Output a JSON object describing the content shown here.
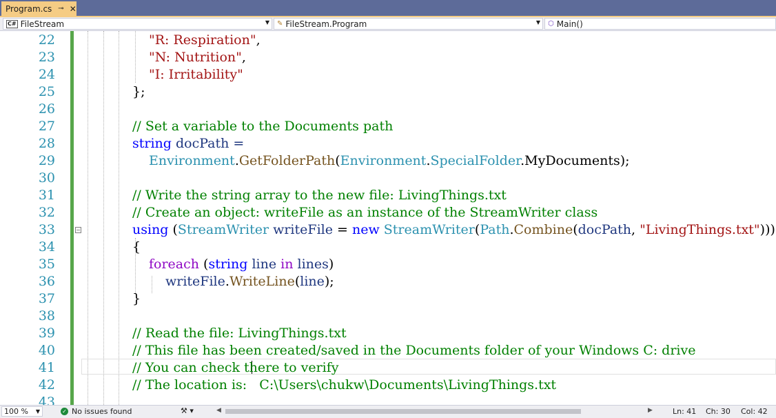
{
  "tab": {
    "title": "Program.cs",
    "pin_glyph": "⊸",
    "close_glyph": "✕"
  },
  "navbar": {
    "project": "FileStream",
    "class": "FileStream.Program",
    "member": "Main()"
  },
  "editor": {
    "line_numbers": [
      "22",
      "23",
      "24",
      "25",
      "26",
      "27",
      "28",
      "29",
      "30",
      "31",
      "32",
      "33",
      "34",
      "35",
      "36",
      "37",
      "38",
      "39",
      "40",
      "41",
      "42",
      "43"
    ]
  },
  "code": {
    "l22": "\"R: Respiration\"",
    "l22b": ",",
    "l23": "\"N: Nutrition\"",
    "l23b": ",",
    "l24": "\"I: Irritability\"",
    "l25": "};",
    "l27": "// Set a variable to the Documents path",
    "l28_kw": "string",
    "l28_rest": " docPath =",
    "l29_t1": "Environment",
    "l29_d1": ".",
    "l29_m1": "GetFolderPath",
    "l29_p1": "(",
    "l29_t2": "Environment",
    "l29_d2": ".",
    "l29_t3": "SpecialFolder",
    "l29_rest": ".MyDocuments);",
    "l31": "// Write the string array to the new file: LivingThings.txt",
    "l32": "// Create an object: writeFile as an instance of the StreamWriter class",
    "l33_kw": "using",
    "l33_p1": " (",
    "l33_t1": "StreamWriter",
    "l33_v1": " writeFile",
    "l33_eq": " = ",
    "l33_kw2": "new",
    "l33_sp": " ",
    "l33_t2": "StreamWriter",
    "l33_p2": "(",
    "l33_t3": "Path",
    "l33_d": ".",
    "l33_m": "Combine",
    "l33_p3": "(",
    "l33_v2": "docPath",
    "l33_c": ", ",
    "l33_s": "\"LivingThings.txt\"",
    "l33_end": ")))",
    "l34": "{",
    "l35_kw": "foreach",
    "l35_p1": " (",
    "l35_kw2": "string",
    "l35_v1": " line",
    "l35_sp": " ",
    "l35_kw3": "in",
    "l35_v2": " lines",
    "l35_end": ")",
    "l36_v": "writeFile",
    "l36_d": ".",
    "l36_m": "WriteLine",
    "l36_p": "(",
    "l36_v2": "line",
    "l36_end": ");",
    "l37": "}",
    "l39": "// Read the file: LivingThings.txt",
    "l40": "// This file has been created/saved in the Documents folder of your Windows C: drive",
    "l41": "// You can check there to verify",
    "l42": "// The location is:   C:\\Users\\chukw\\Documents\\LivingThings.txt"
  },
  "statusbar": {
    "zoom": "100 %",
    "issues": "No issues found",
    "ln": "Ln: 41",
    "ch": "Ch: 30",
    "col": "Col: 42"
  },
  "colors": {
    "keyword": "#0000ff",
    "type": "#2b91af",
    "string": "#a31515",
    "comment": "#008000",
    "control": "#8f08c4",
    "variable": "#1f377f",
    "method": "#74531f",
    "tab_active": "#f5cc84",
    "tabstrip": "#5d6b99",
    "change_bar": "#57a64a"
  }
}
